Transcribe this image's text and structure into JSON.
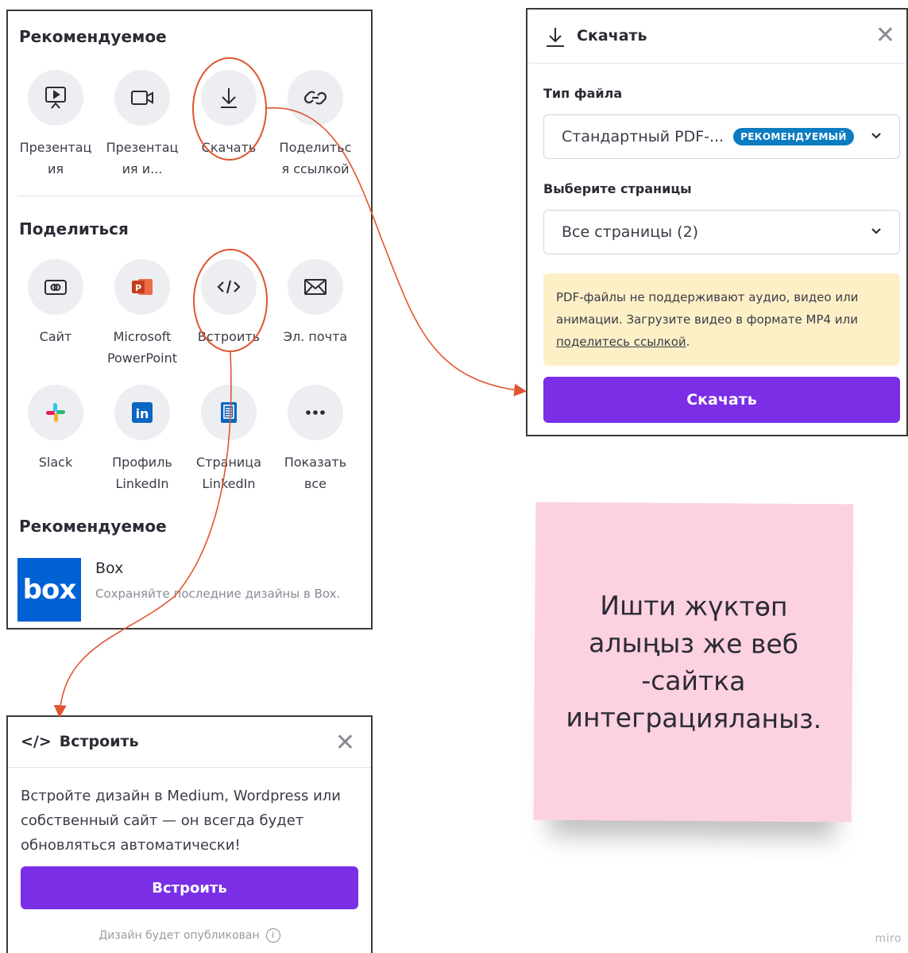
{
  "share_panel": {
    "recommended_title": "Рекомендуемое",
    "recommended_items": [
      {
        "label": "Презентац\nия",
        "icon": "presentation-icon"
      },
      {
        "label": "Презентац\nия и...",
        "icon": "video-icon"
      },
      {
        "label": "Скачать",
        "icon": "download-icon"
      },
      {
        "label": "Поделитьс\nя ссылкой",
        "icon": "link-icon"
      }
    ],
    "share_title": "Поделиться",
    "share_items": [
      {
        "label": "Сайт",
        "icon": "website-icon"
      },
      {
        "label": "Microsoft\nPowerPoint",
        "icon": "powerpoint-icon"
      },
      {
        "label": "Встроить",
        "icon": "embed-code-icon"
      },
      {
        "label": "Эл. почта",
        "icon": "email-icon"
      },
      {
        "label": "Slack",
        "icon": "slack-icon"
      },
      {
        "label": "Профиль\nLinkedIn",
        "icon": "linkedin-icon"
      },
      {
        "label": "Страница\nLinkedIn",
        "icon": "linkedin-page-icon"
      },
      {
        "label": "Показать\nвсе",
        "icon": "more-icon"
      }
    ],
    "recommended_title_2": "Рекомендуемое",
    "box": {
      "logo_text": "box",
      "title": "Box",
      "description": "Сохраняйте последние дизайны в Box."
    }
  },
  "download_dialog": {
    "title": "Скачать",
    "file_type_label": "Тип файла",
    "file_type_value": "Стандартный PDF-...",
    "file_type_badge": "РЕКОМЕНДУЕМЫЙ",
    "pages_label": "Выберите страницы",
    "pages_value": "Все страницы (2)",
    "warning_text": "PDF-файлы не поддерживают аудио, видео или анимации. Загрузите видео в формате MP4 или",
    "warning_link": "поделитесь ссылкой",
    "warning_end": ".",
    "button_label": "Скачать"
  },
  "embed_dialog": {
    "code_symbol": "</>",
    "title": "Встроить",
    "description": "Встройте дизайн в Medium, Wordpress или собственный сайт — он всегда будет обновляться автоматически!",
    "button_label": "Встроить",
    "note": "Дизайн будет опубликован"
  },
  "sticky_note": {
    "text": "Ишти жүктөп алыңыз же веб -сайтка интеграцияланыз."
  },
  "watermark": "miro",
  "colors": {
    "accent_purple": "#7a2ee6",
    "badge_blue": "#0b7cc2",
    "annotation_red": "#e0552f",
    "sticky_pink": "#fcd1e0",
    "warning_yellow": "#fdf0c6",
    "box_blue": "#0061d5"
  }
}
